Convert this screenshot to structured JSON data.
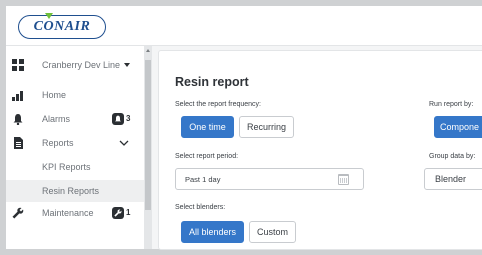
{
  "app": {
    "brand": "CONAIR"
  },
  "sidebar": {
    "line_selector": "Cranberry Dev Line",
    "items": [
      {
        "label": "Home",
        "icon": "bar-chart-icon"
      },
      {
        "label": "Alarms",
        "icon": "bell-icon",
        "badge": "3"
      },
      {
        "label": "Reports",
        "icon": "document-icon"
      },
      {
        "label": "KPI Reports"
      },
      {
        "label": "Resin Reports"
      },
      {
        "label": "Maintenance",
        "icon": "wrench-icon",
        "badge": "1"
      }
    ]
  },
  "report": {
    "title": "Resin report",
    "frequency_label": "Select the report frequency:",
    "frequency_options": [
      "One time",
      "Recurring"
    ],
    "run_by_label": "Run report by:",
    "run_by_value": "Compone",
    "period_label": "Select report period:",
    "period_value": "Past 1 day",
    "group_label": "Group data by:",
    "group_value": "Blender",
    "blenders_label": "Select blenders:",
    "blender_options": [
      "All blenders",
      "Custom"
    ]
  },
  "colors": {
    "accent": "#3577c9",
    "brand": "#1f4f8f",
    "leaf": "#6fbf3a"
  }
}
